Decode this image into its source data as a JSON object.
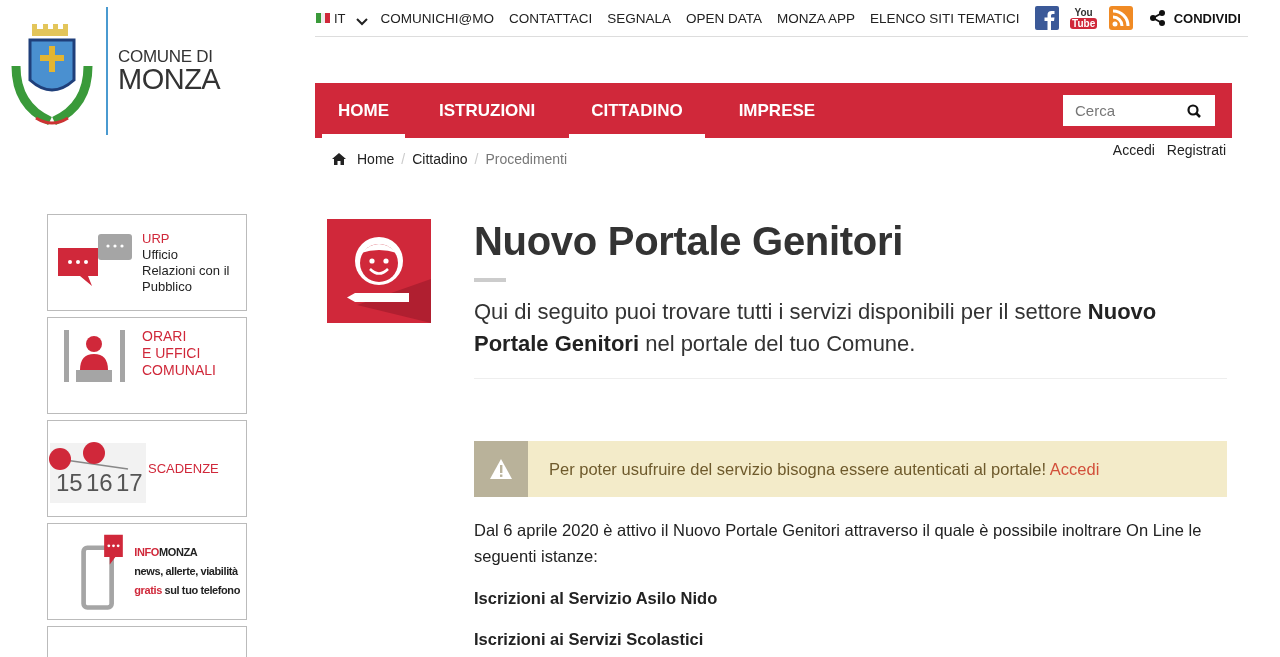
{
  "logo": {
    "line1": "COMUNE DI",
    "line2": "MONZA"
  },
  "top_bar": {
    "language": "IT",
    "links": [
      "COMUNICHI@MO",
      "CONTATTACI",
      "SEGNALA",
      "OPEN DATA",
      "MONZA APP",
      "ELENCO SITI TEMATICI"
    ],
    "youtube": [
      "You",
      "Tube"
    ],
    "share": "CONDIVIDI"
  },
  "nav": {
    "items": [
      {
        "label": "HOME",
        "selected": true
      },
      {
        "label": "ISTRUZIONI",
        "selected": false
      },
      {
        "label": "CITTADINO",
        "selected": true
      },
      {
        "label": "IMPRESE",
        "selected": false
      }
    ],
    "search": {
      "placeholder": "Cerca"
    }
  },
  "breadcrumb": {
    "items": [
      "Home",
      "Cittadino",
      "Procedimenti"
    ],
    "separator": "/"
  },
  "account_links": [
    "Accedi",
    "Registrati"
  ],
  "banners": [
    {
      "kind": "urp",
      "lines": [
        [
          {
            "t": "URP",
            "red": true
          }
        ],
        [
          {
            "t": "Ufficio",
            "red": false
          }
        ],
        [
          {
            "t": "Relazioni con il",
            "red": false
          }
        ],
        [
          {
            "t": "Pubblico",
            "red": false
          }
        ]
      ]
    },
    {
      "kind": "orari",
      "lines": [
        [
          {
            "t": "ORARI",
            "red": true
          }
        ],
        [
          {
            "t": "E UFFICI",
            "red": true
          }
        ],
        [
          {
            "t": "COMUNALI",
            "red": true
          }
        ]
      ]
    },
    {
      "kind": "scadenze",
      "numbers": [
        "15",
        "16",
        "17"
      ],
      "lines": [
        [
          {
            "t": "SCADENZE",
            "red": true
          }
        ]
      ]
    },
    {
      "kind": "infomonza",
      "lines": [
        [
          {
            "t": "INFO",
            "red": true
          },
          {
            "t": "MONZA",
            "red": false
          }
        ],
        [
          {
            "t": "news, allerte, viabilità",
            "red": false
          }
        ],
        [
          {
            "t": "gratis",
            "red": true
          },
          {
            "t": " sul tuo telefono",
            "red": false
          }
        ]
      ]
    },
    {
      "kind": "cut"
    }
  ],
  "page": {
    "title": "Nuovo Portale Genitori",
    "lead": "Qui di seguito puoi trovare tutti i servizi disponibili per il settore **Nuovo Portale Genitori** nel portale del tuo Comune.",
    "alert": {
      "text": "Per poter usufruire del servizio bisogna essere autenticati al portale!",
      "link": "Accedi"
    },
    "body": "Dal 6 aprile 2020 è attivo il Nuovo Portale Genitori attraverso il quale è possibile inoltrare On Line le seguenti istanze:",
    "items": [
      "Iscrizioni al Servizio Asilo Nido",
      "Iscrizioni ai Servizi Scolastici"
    ]
  }
}
